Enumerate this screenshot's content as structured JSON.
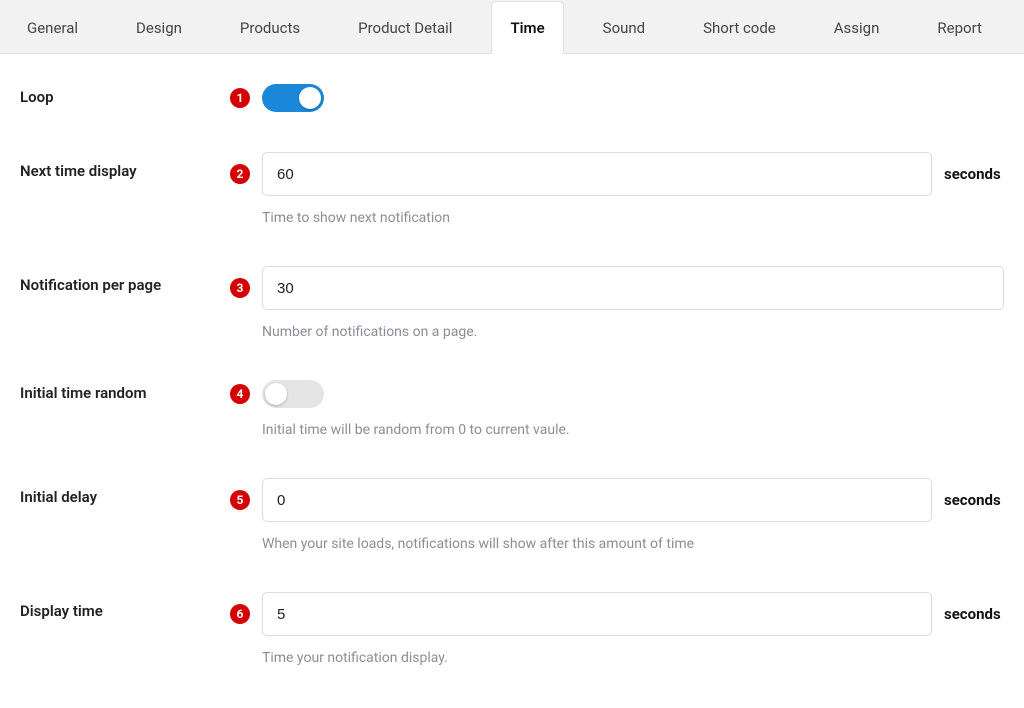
{
  "tabs": {
    "items": [
      {
        "label": "General"
      },
      {
        "label": "Design"
      },
      {
        "label": "Products"
      },
      {
        "label": "Product Detail"
      },
      {
        "label": "Time",
        "active": true
      },
      {
        "label": "Sound"
      },
      {
        "label": "Short code"
      },
      {
        "label": "Assign"
      },
      {
        "label": "Report"
      }
    ]
  },
  "markers": {
    "m1": "1",
    "m2": "2",
    "m3": "3",
    "m4": "4",
    "m5": "5",
    "m6": "6"
  },
  "fields": {
    "loop": {
      "label": "Loop",
      "value": true
    },
    "next_time": {
      "label": "Next time display",
      "value": "60",
      "unit": "seconds",
      "help": "Time to show next notification"
    },
    "per_page": {
      "label": "Notification per page",
      "value": "30",
      "help": "Number of notifications on a page."
    },
    "initial_random": {
      "label": "Initial time random",
      "value": false,
      "help": "Initial time will be random from 0 to current vaule."
    },
    "initial_delay": {
      "label": "Initial delay",
      "value": "0",
      "unit": "seconds",
      "help": "When your site loads, notifications will show after this amount of time"
    },
    "display_time": {
      "label": "Display time",
      "value": "5",
      "unit": "seconds",
      "help": "Time your notification display."
    }
  }
}
